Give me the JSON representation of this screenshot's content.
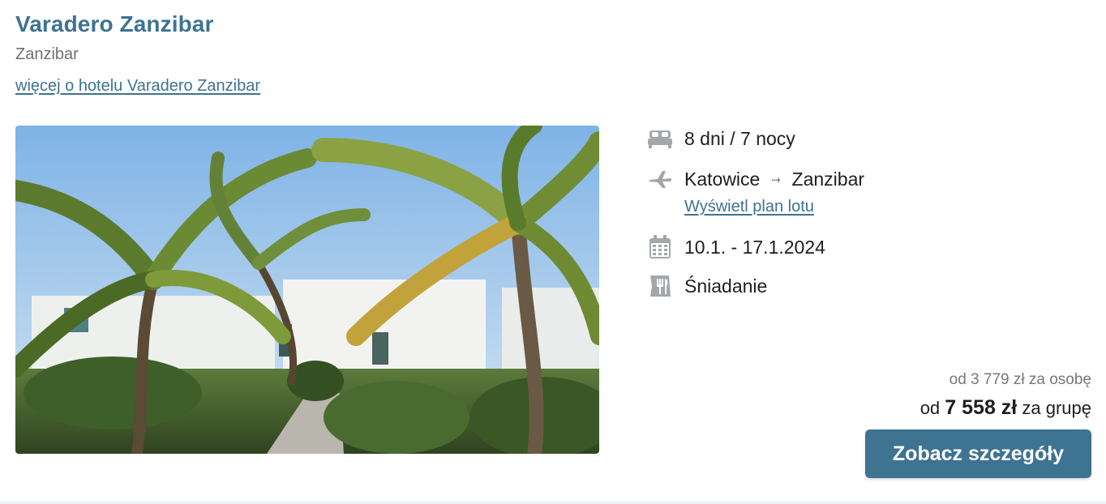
{
  "hotel": {
    "name": "Varadero Zanzibar",
    "region": "Zanzibar",
    "more_link": "więcej o hotelu Varadero Zanzibar"
  },
  "trip": {
    "duration": "8 dni / 7 nocy",
    "origin": "Katowice",
    "arrow": "⤑",
    "destination": "Zanzibar",
    "flight_plan_link": "Wyświetl plan lotu",
    "dates": "10.1. - 17.1.2024",
    "board": "Śniadanie",
    "icons": [
      "bed-icon",
      "plane-icon",
      "calendar-icon",
      "meal-icon"
    ]
  },
  "price": {
    "per_person": "od 3 779 zł za osobę",
    "group_prefix": "od",
    "group_amount": "7 558 zł",
    "group_suffix": "za grupę"
  },
  "cta_label": "Zobacz szczegóły",
  "colors": {
    "accent": "#3e7391",
    "icon": "#a3a7aa"
  }
}
